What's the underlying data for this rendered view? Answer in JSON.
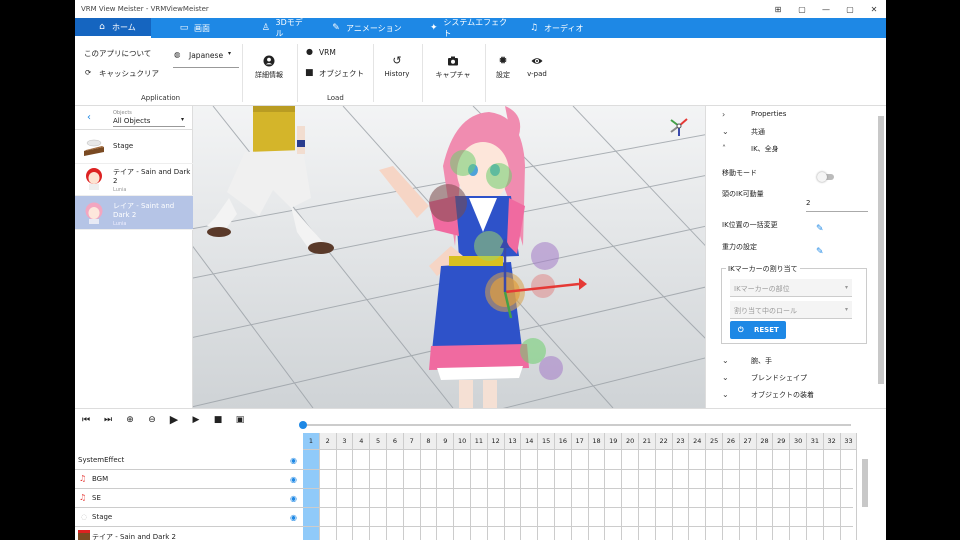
{
  "window": {
    "title": "VRM View Meister - VRMViewMeister",
    "controls": [
      "⊞",
      "▢",
      "—",
      "▢",
      "✕"
    ]
  },
  "menu": {
    "tabs": [
      {
        "label": "ホーム",
        "icon": "home-icon",
        "active": true
      },
      {
        "label": "画面",
        "icon": "screen-icon"
      },
      {
        "label": "3Dモデル",
        "icon": "person-icon"
      },
      {
        "label": "アニメーション",
        "icon": "animation-icon"
      },
      {
        "label": "システムエフェクト",
        "icon": "effects-icon"
      },
      {
        "label": "オーディオ",
        "icon": "headphones-icon"
      }
    ]
  },
  "ribbon": {
    "about": "このアプリについて",
    "clear_cache": "キャッシュクリア",
    "language": "Japanese",
    "application_group": "Application",
    "details": "詳細情報",
    "vrm": "VRM",
    "object": "オブジェクト",
    "load_group": "Load",
    "history": "History",
    "capture": "キャプチャ",
    "settings": "設定",
    "vpad": "v-pad"
  },
  "objects": {
    "header_small": "Objects",
    "filter": "All Objects",
    "items": [
      {
        "name": "Stage",
        "sub": ""
      },
      {
        "name": "テイア - Sain and Dark 2",
        "sub": "Lunia"
      },
      {
        "name": "レイア - Saint and Dark 2",
        "sub": "Lunia",
        "selected": true
      }
    ]
  },
  "properties": {
    "rows": [
      {
        "chev": "›",
        "label": "Properties"
      },
      {
        "chev": "⌄",
        "label": "共通"
      },
      {
        "chev": "˄",
        "label": "IK、全身"
      }
    ],
    "move_mode": "移動モード",
    "head_ik": "頭のIK可動量",
    "head_ik_value": "2",
    "ik_bulk": "IK位置の一括変更",
    "gravity": "重力の設定",
    "ik_marker_legend": "IKマーカーの割り当て",
    "ik_marker_part": "IKマーカーの部位",
    "ik_role": "割り当て中のロール",
    "reset": "RESET",
    "more_rows": [
      {
        "chev": "⌄",
        "label": "腕、手"
      },
      {
        "chev": "⌄",
        "label": "ブレンドシェイプ"
      },
      {
        "chev": "⌄",
        "label": "オブジェクトの装着"
      }
    ]
  },
  "timeline": {
    "frames": [
      "1",
      "2",
      "3",
      "4",
      "5",
      "6",
      "7",
      "8",
      "9",
      "10",
      "11",
      "12",
      "13",
      "14",
      "15",
      "16",
      "17",
      "18",
      "19",
      "20",
      "21",
      "22",
      "23",
      "24",
      "25",
      "26",
      "27",
      "28",
      "29",
      "30",
      "31",
      "32",
      "33"
    ],
    "tracks": [
      {
        "name": "SystemEffect"
      },
      {
        "name": "BGM"
      },
      {
        "name": "SE"
      },
      {
        "name": "Stage"
      },
      {
        "name": "テイア - Sain and Dark 2"
      }
    ]
  },
  "colors": {
    "accent": "#1e88e5",
    "selected_row": "#b5c4e6",
    "frame_highlight": "#90caf9"
  }
}
